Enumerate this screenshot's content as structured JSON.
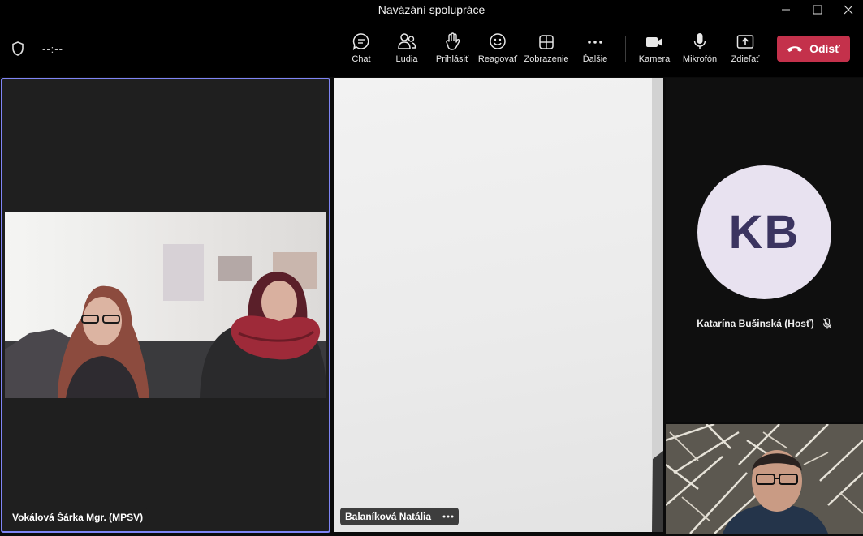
{
  "window": {
    "title": "Navázání spolupráce"
  },
  "toolbar": {
    "timer": "--:--",
    "chat": "Chat",
    "people": "Ľudia",
    "raise_hand": "Prihlásiť",
    "react": "Reagovať",
    "view": "Zobrazenie",
    "more": "Ďalšie",
    "camera": "Kamera",
    "mic": "Mikrofón",
    "share": "Zdieľať",
    "leave": "Odísť"
  },
  "tiles": {
    "tile1": {
      "name": "Vokálová Šárka Mgr. (MPSV)"
    },
    "tile2": {
      "name": "Balaníková Natália"
    },
    "tile3": {
      "initials": "KB",
      "name": "Katarína Bušinská (Hosť)"
    }
  },
  "colors": {
    "accent": "#7f85f5",
    "leave": "#c4314b",
    "avatar_bg": "#e8e2f0",
    "avatar_text": "#3b3460"
  }
}
